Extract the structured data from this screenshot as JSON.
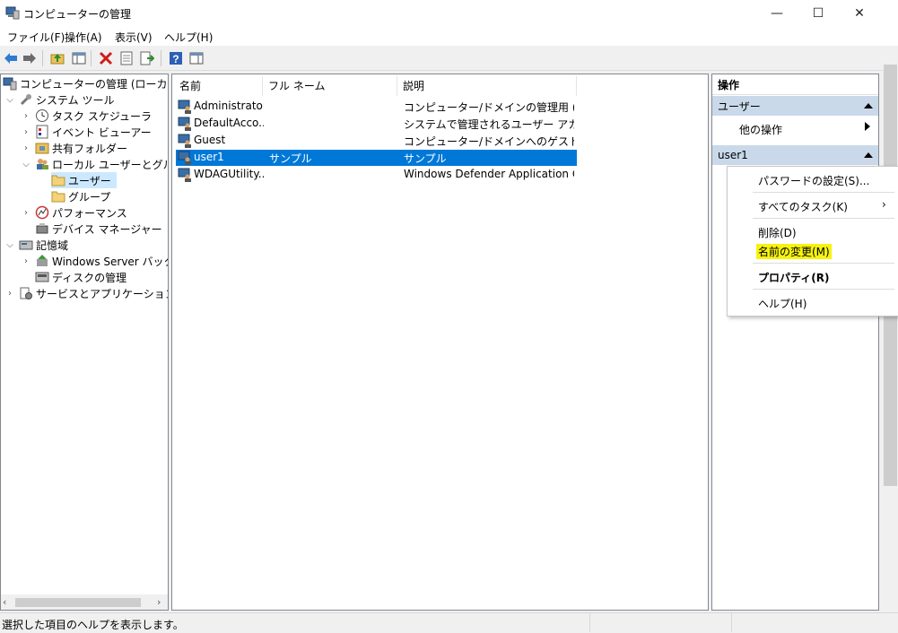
{
  "window": {
    "title": "コンピューターの管理",
    "minimize_glyph": "—",
    "maximize_glyph": "☐",
    "close_glyph": "✕"
  },
  "menubar": [
    {
      "label": "ファイル(F)"
    },
    {
      "label": "操作(A)"
    },
    {
      "label": "表示(V)"
    },
    {
      "label": "ヘルプ(H)"
    }
  ],
  "toolbar": {
    "icons": [
      "back-arrow-icon",
      "forward-arrow-icon",
      "up-folder-icon",
      "show-hide-tree-icon",
      "delete-icon",
      "properties-icon",
      "export-list-icon",
      "help-icon",
      "show-hide-action-pane-icon"
    ]
  },
  "tree": {
    "root": "コンピューターの管理 (ローカル)",
    "system_tools": "システム ツール",
    "task_scheduler": "タスク スケジューラ",
    "event_viewer": "イベント ビューアー",
    "shared_folders": "共有フォルダー",
    "local_users_groups": "ローカル ユーザーとグループ",
    "users": "ユーザー",
    "groups": "グループ",
    "performance": "パフォーマンス",
    "device_manager": "デバイス マネージャー",
    "storage": "記憶域",
    "windows_server_backup": "Windows Server バックア",
    "disk_management": "ディスクの管理",
    "services_apps": "サービスとアプリケーション"
  },
  "list": {
    "columns": [
      "名前",
      "フル ネーム",
      "説明"
    ],
    "rows": [
      {
        "name": "Administrator",
        "full_name": "",
        "description": "コンピューター/ドメインの管理用 (ビルト..."
      },
      {
        "name": "DefaultAcco...",
        "full_name": "",
        "description": "システムで管理されるユーザー アカウン..."
      },
      {
        "name": "Guest",
        "full_name": "",
        "description": "コンピューター/ドメインへのゲスト アクセ..."
      },
      {
        "name": "user1",
        "full_name": "サンプル",
        "description": "サンプル",
        "selected": true
      },
      {
        "name": "WDAGUtility...",
        "full_name": "",
        "description": "Windows Defender Application G..."
      }
    ]
  },
  "actions": {
    "header": "操作",
    "section_users": "ユーザー",
    "other_actions": "他の操作",
    "section_user1": "user1"
  },
  "context_menu": {
    "set_password": "パスワードの設定(S)...",
    "all_tasks": "すべてのタスク(K)",
    "delete": "削除(D)",
    "rename": "名前の変更(M)",
    "properties": "プロパティ(R)",
    "help": "ヘルプ(H)",
    "highlight_color": "#f7f30f"
  },
  "status": {
    "text": "選択した項目のヘルプを表示します。"
  },
  "colors": {
    "selection": "#0078d7",
    "section_header": "#c9d9ea",
    "tree_selection": "#cce8ff"
  }
}
